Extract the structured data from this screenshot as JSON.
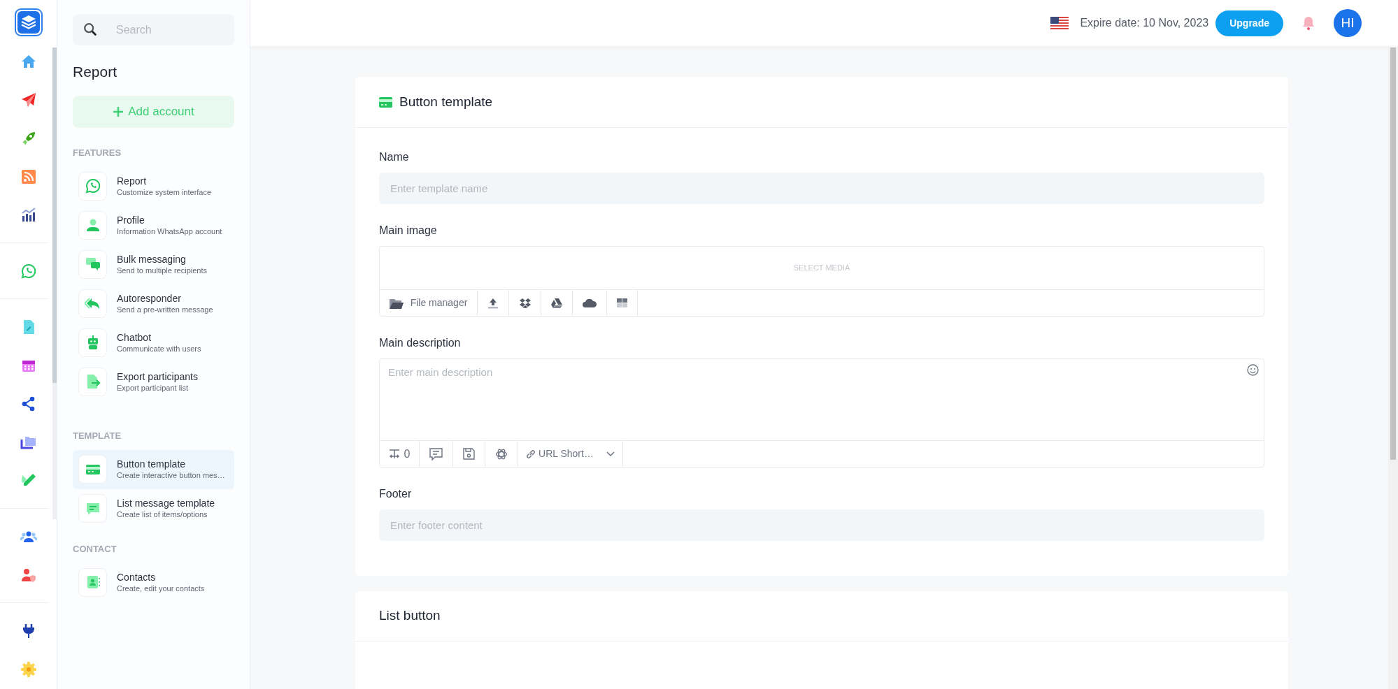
{
  "search": {
    "placeholder": "Search"
  },
  "sidebar": {
    "title": "Report",
    "add_button": "Add account",
    "sections": [
      {
        "heading": "FEATURES",
        "items": [
          {
            "title": "Report",
            "subtitle": "Customize system interface",
            "selected": false
          },
          {
            "title": "Profile",
            "subtitle": "Information WhatsApp account",
            "selected": false
          },
          {
            "title": "Bulk messaging",
            "subtitle": "Send to multiple recipients",
            "selected": false
          },
          {
            "title": "Autoresponder",
            "subtitle": "Send a pre-written message",
            "selected": false
          },
          {
            "title": "Chatbot",
            "subtitle": "Communicate with users",
            "selected": false
          },
          {
            "title": "Export participants",
            "subtitle": "Export participant list",
            "selected": false
          }
        ]
      },
      {
        "heading": "TEMPLATE",
        "items": [
          {
            "title": "Button template",
            "subtitle": "Create interactive button mes…",
            "selected": true
          },
          {
            "title": "List message template",
            "subtitle": "Create list of items/options",
            "selected": false
          }
        ]
      },
      {
        "heading": "CONTACT",
        "items": [
          {
            "title": "Contacts",
            "subtitle": "Create, edit your contacts",
            "selected": false
          }
        ]
      }
    ]
  },
  "header": {
    "expire_date": "Expire date: 10 Nov, 2023",
    "upgrade_button": "Upgrade",
    "avatar": "HI"
  },
  "form_card": {
    "title": "Button template",
    "fields": [
      {
        "kind": "input",
        "label": "Name",
        "placeholder": "Enter template name"
      },
      {
        "kind": "media",
        "label": "Main image",
        "hint": "SELECT MEDIA",
        "file_manager": "File manager"
      },
      {
        "kind": "textarea",
        "label": "Main description",
        "placeholder": "Enter main description",
        "counter": "0",
        "url_shortener": "URL Short…"
      },
      {
        "kind": "input",
        "label": "Footer",
        "placeholder": "Enter footer content"
      }
    ]
  },
  "list_card": {
    "title": "List button"
  }
}
